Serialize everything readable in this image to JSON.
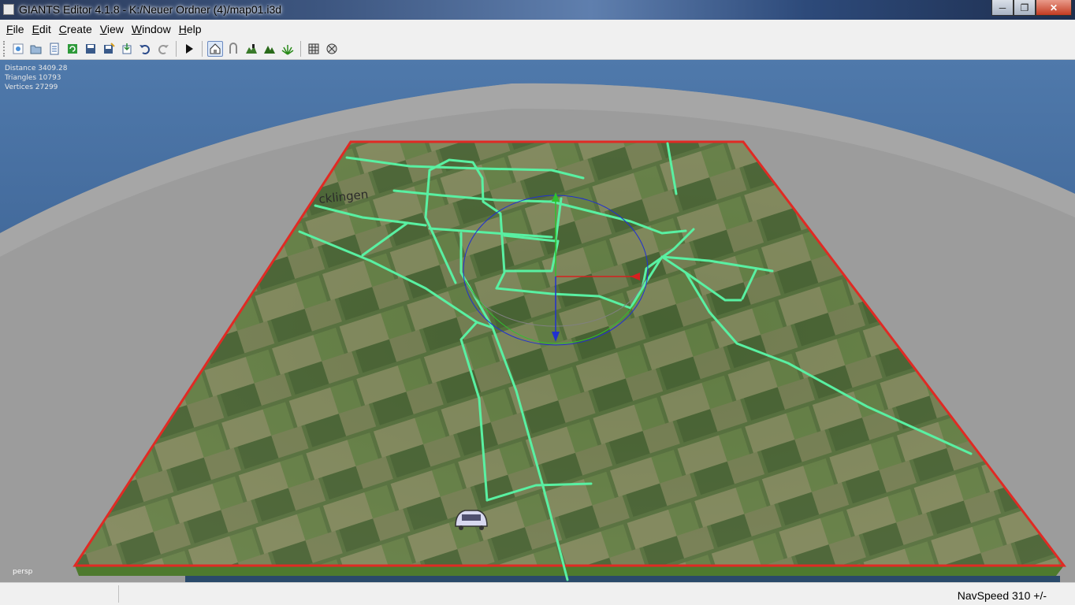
{
  "window": {
    "title": "GIANTS Editor 4.1.8 - K:/Neuer Ordner (4)/map01.i3d"
  },
  "menu": [
    {
      "label": "File",
      "mnemonic": "F",
      "rest": "ile"
    },
    {
      "label": "Edit",
      "mnemonic": "E",
      "rest": "dit"
    },
    {
      "label": "Create",
      "mnemonic": "C",
      "rest": "reate"
    },
    {
      "label": "View",
      "mnemonic": "V",
      "rest": "iew"
    },
    {
      "label": "Window",
      "mnemonic": "W",
      "rest": "indow"
    },
    {
      "label": "Help",
      "mnemonic": "H",
      "rest": "elp"
    }
  ],
  "toolbar": {
    "buttons": [
      "new-scene-icon",
      "open-icon",
      "properties-icon",
      "refresh-icon",
      "save-icon",
      "save-as-icon",
      "import-icon",
      "undo-icon",
      "redo-icon",
      "play-icon",
      "select-mode-icon",
      "terrain-sculpt-icon",
      "terrain-paint-icon",
      "foliage-paint-icon",
      "grass-paint-icon",
      "grid-icon",
      "snap-icon"
    ],
    "active": "select-mode-icon"
  },
  "viewport": {
    "stats": {
      "distance": "Distance 3409.28",
      "triangles": "Triangles 10793",
      "vertices": "Vertices 27299"
    },
    "camera_label": "persp",
    "map_label": "cklingen"
  },
  "status": {
    "navspeed": "NavSpeed 310 +/-"
  },
  "colors": {
    "road": "#59f0a2",
    "border": "#e02a24",
    "sky": "#3a5f93",
    "ground_plane": "#9a9a9a",
    "gizmo_x": "#d62020",
    "gizmo_y": "#30c030",
    "gizmo_z": "#2030d0"
  }
}
